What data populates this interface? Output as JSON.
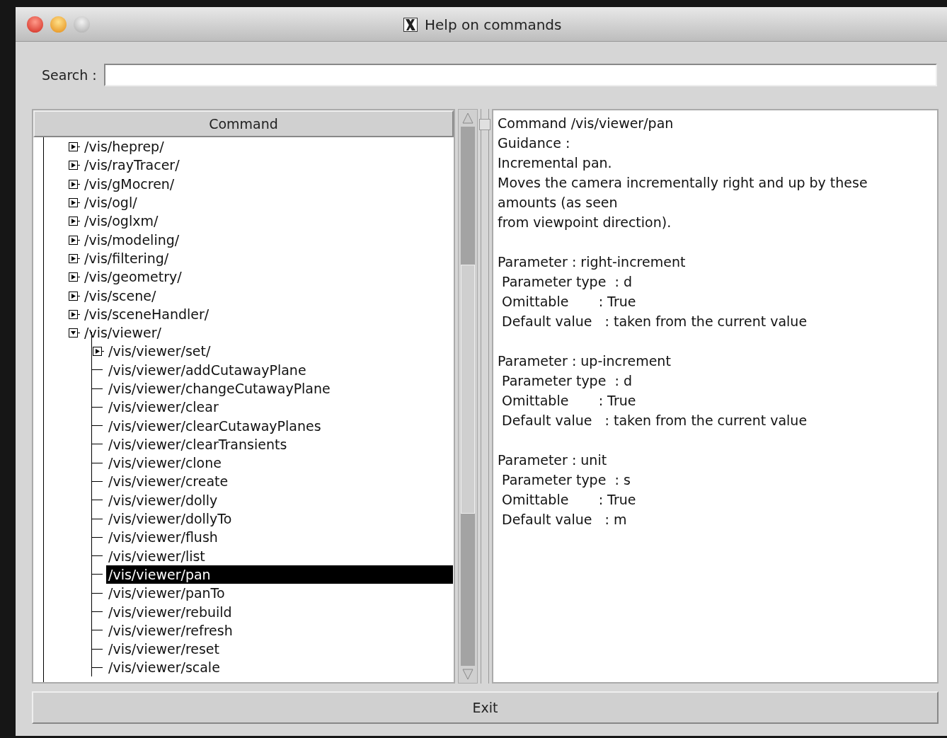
{
  "window": {
    "title": "Help on commands"
  },
  "search": {
    "label": "Search :"
  },
  "tree": {
    "header": "Command",
    "items": [
      {
        "label": "/vis/heprep/",
        "kind": "branch",
        "expanded": false,
        "selected": false
      },
      {
        "label": "/vis/rayTracer/",
        "kind": "branch",
        "expanded": false,
        "selected": false
      },
      {
        "label": "/vis/gMocren/",
        "kind": "branch",
        "expanded": false,
        "selected": false
      },
      {
        "label": "/vis/ogl/",
        "kind": "branch",
        "expanded": false,
        "selected": false
      },
      {
        "label": "/vis/oglxm/",
        "kind": "branch",
        "expanded": false,
        "selected": false
      },
      {
        "label": "/vis/modeling/",
        "kind": "branch",
        "expanded": false,
        "selected": false
      },
      {
        "label": "/vis/filtering/",
        "kind": "branch",
        "expanded": false,
        "selected": false
      },
      {
        "label": "/vis/geometry/",
        "kind": "branch",
        "expanded": false,
        "selected": false
      },
      {
        "label": "/vis/scene/",
        "kind": "branch",
        "expanded": false,
        "selected": false
      },
      {
        "label": "/vis/sceneHandler/",
        "kind": "branch",
        "expanded": false,
        "selected": false
      },
      {
        "label": "/vis/viewer/",
        "kind": "branch",
        "expanded": true,
        "selected": false,
        "children": [
          {
            "label": "/vis/viewer/set/",
            "kind": "branch",
            "expanded": false,
            "selected": false
          },
          {
            "label": "/vis/viewer/addCutawayPlane",
            "kind": "leaf",
            "selected": false
          },
          {
            "label": "/vis/viewer/changeCutawayPlane",
            "kind": "leaf",
            "selected": false
          },
          {
            "label": "/vis/viewer/clear",
            "kind": "leaf",
            "selected": false
          },
          {
            "label": "/vis/viewer/clearCutawayPlanes",
            "kind": "leaf",
            "selected": false
          },
          {
            "label": "/vis/viewer/clearTransients",
            "kind": "leaf",
            "selected": false
          },
          {
            "label": "/vis/viewer/clone",
            "kind": "leaf",
            "selected": false
          },
          {
            "label": "/vis/viewer/create",
            "kind": "leaf",
            "selected": false
          },
          {
            "label": "/vis/viewer/dolly",
            "kind": "leaf",
            "selected": false
          },
          {
            "label": "/vis/viewer/dollyTo",
            "kind": "leaf",
            "selected": false
          },
          {
            "label": "/vis/viewer/flush",
            "kind": "leaf",
            "selected": false
          },
          {
            "label": "/vis/viewer/list",
            "kind": "leaf",
            "selected": false
          },
          {
            "label": "/vis/viewer/pan",
            "kind": "leaf",
            "selected": true
          },
          {
            "label": "/vis/viewer/panTo",
            "kind": "leaf",
            "selected": false
          },
          {
            "label": "/vis/viewer/rebuild",
            "kind": "leaf",
            "selected": false
          },
          {
            "label": "/vis/viewer/refresh",
            "kind": "leaf",
            "selected": false
          },
          {
            "label": "/vis/viewer/reset",
            "kind": "leaf",
            "selected": false
          },
          {
            "label": "/vis/viewer/scale",
            "kind": "leaf",
            "selected": false
          }
        ]
      }
    ]
  },
  "help": {
    "sections": [
      [
        "Command /vis/viewer/pan",
        "Guidance :",
        "Incremental pan.",
        "Moves the camera incrementally right and up by these",
        "amounts (as seen",
        "from viewpoint direction)."
      ],
      [
        "Parameter : right-increment",
        " Parameter type  : d",
        " Omittable       : True",
        " Default value   : taken from the current value"
      ],
      [
        "Parameter : up-increment",
        " Parameter type  : d",
        " Omittable       : True",
        " Default value   : taken from the current value"
      ],
      [
        "Parameter : unit",
        " Parameter type  : s",
        " Omittable       : True",
        " Default value   : m"
      ]
    ]
  },
  "exit_button": "Exit"
}
